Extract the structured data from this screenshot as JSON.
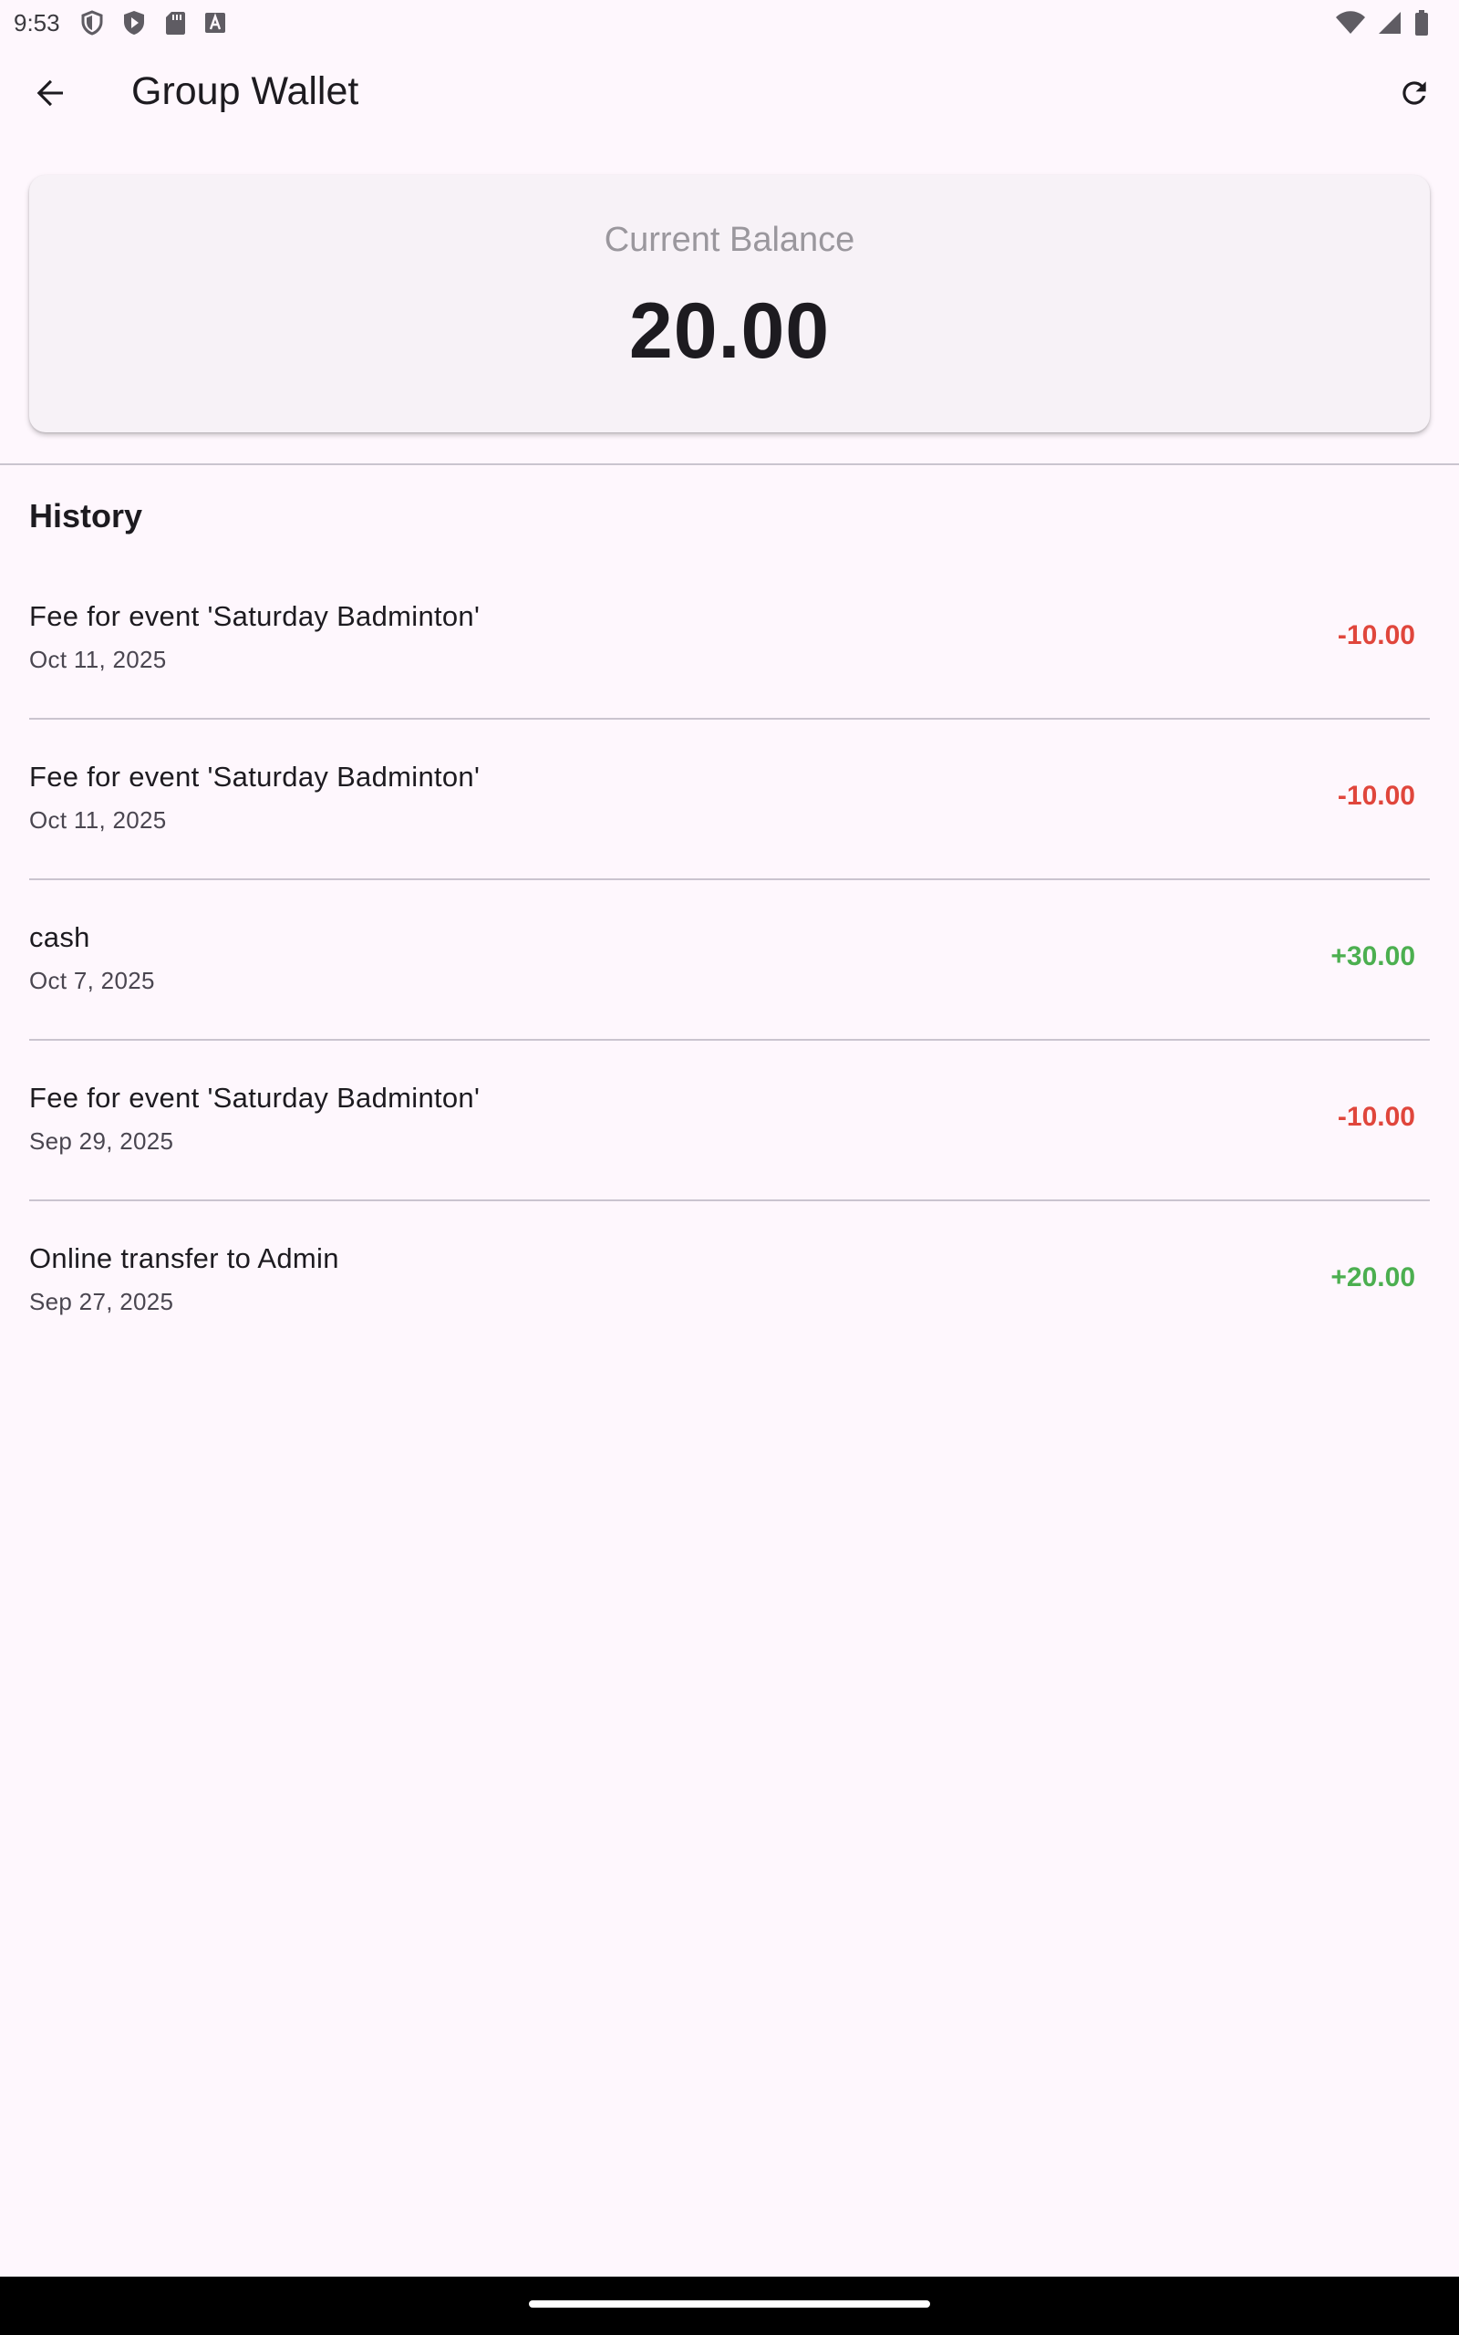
{
  "status_bar": {
    "time": "9:53",
    "left_icons": [
      "shield-icon",
      "play-protect-icon",
      "sd-card-icon",
      "font-a-icon"
    ],
    "right_icons": [
      "wifi-icon",
      "cell-signal-icon",
      "battery-icon"
    ]
  },
  "app_bar": {
    "title": "Group Wallet",
    "back_icon": "arrow-back-icon",
    "refresh_icon": "refresh-icon"
  },
  "balance": {
    "label": "Current Balance",
    "value": "20.00"
  },
  "history": {
    "heading": "History",
    "items": [
      {
        "description": "Fee for event 'Saturday Badminton'",
        "date": "Oct 11, 2025",
        "amount": "-10.00",
        "type": "debit"
      },
      {
        "description": "Fee for event 'Saturday Badminton'",
        "date": "Oct 11, 2025",
        "amount": "-10.00",
        "type": "debit"
      },
      {
        "description": "cash",
        "date": "Oct 7, 2025",
        "amount": "+30.00",
        "type": "credit"
      },
      {
        "description": "Fee for event 'Saturday Badminton'",
        "date": "Sep 29, 2025",
        "amount": "-10.00",
        "type": "debit"
      },
      {
        "description": "Online transfer to Admin",
        "date": "Sep 27, 2025",
        "amount": "+20.00",
        "type": "credit"
      }
    ]
  },
  "colors": {
    "debit": "#e0463c",
    "credit": "#4caf50",
    "background": "#fef7fd"
  }
}
